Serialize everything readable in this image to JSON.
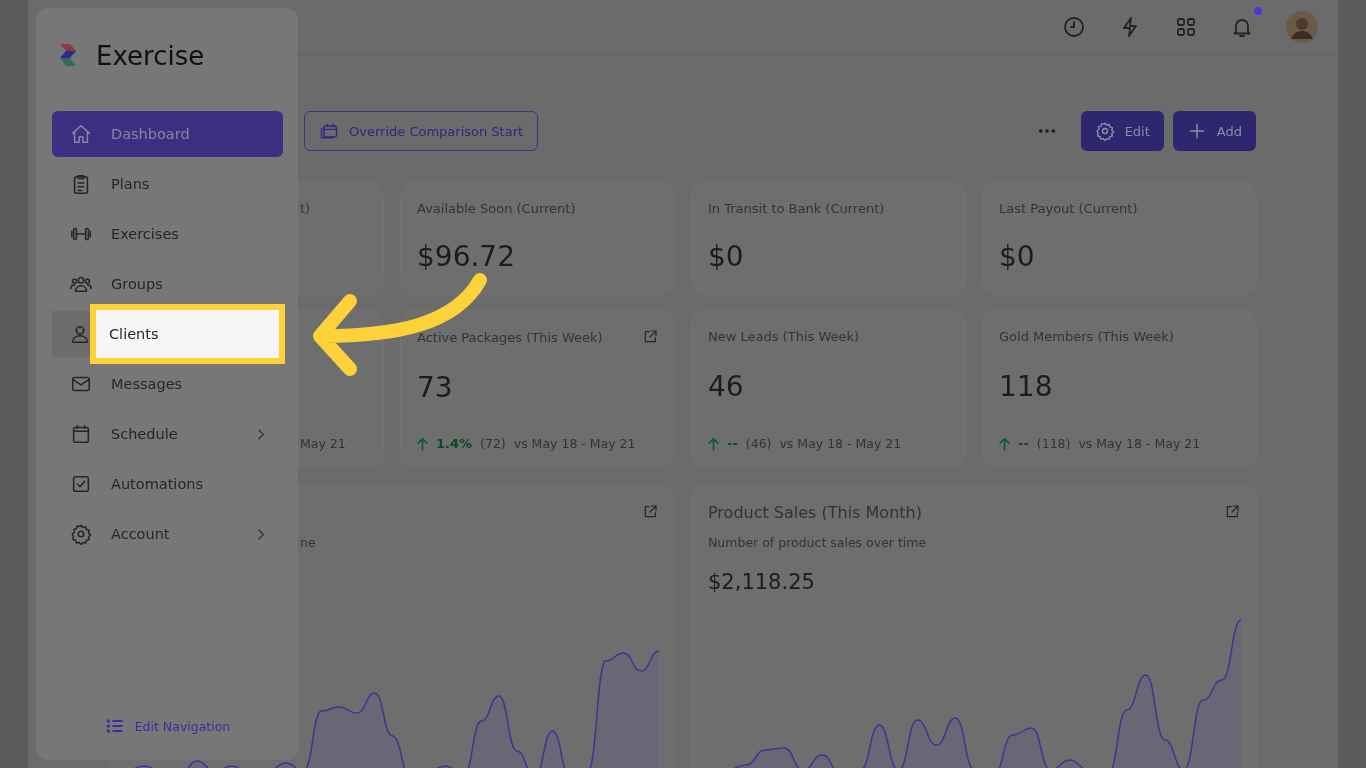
{
  "header": {
    "notifications_unread": true
  },
  "sidebar": {
    "logo": "Exercise",
    "items": [
      {
        "label": "Dashboard",
        "selected": true,
        "highlighted": false,
        "chevron": false
      },
      {
        "label": "Plans",
        "selected": false,
        "highlighted": false,
        "chevron": false
      },
      {
        "label": "Exercises",
        "selected": false,
        "highlighted": false,
        "chevron": false
      },
      {
        "label": "Groups",
        "selected": false,
        "highlighted": false,
        "chevron": false
      },
      {
        "label": "Clients",
        "selected": false,
        "highlighted": true,
        "chevron": false
      },
      {
        "label": "Messages",
        "selected": false,
        "highlighted": false,
        "chevron": false
      },
      {
        "label": "Schedule",
        "selected": false,
        "highlighted": false,
        "chevron": true
      },
      {
        "label": "Automations",
        "selected": false,
        "highlighted": false,
        "chevron": false
      },
      {
        "label": "Account",
        "selected": false,
        "highlighted": false,
        "chevron": true
      }
    ],
    "edit_navigation": "Edit Navigation"
  },
  "toolbar": {
    "override_button": "Override Comparison Start",
    "edit_button": "Edit",
    "add_button": "Add"
  },
  "stat_cards": [
    {
      "kind": "covered",
      "title": "t)"
    },
    {
      "kind": "full",
      "title": "Available Soon (Current)",
      "value": "$96.72",
      "link": false
    },
    {
      "kind": "full",
      "title": "In Transit to Bank (Current)",
      "value": "$0",
      "link": false
    },
    {
      "kind": "full",
      "title": "Last Payout (Current)",
      "value": "$0",
      "link": false
    },
    {
      "kind": "covered",
      "footer": "May 21"
    },
    {
      "kind": "full",
      "title": "Active Packages (This Week)",
      "value": "73",
      "link": true,
      "trend": {
        "change": "1.4%",
        "previous": "(72)",
        "range": "vs May 18 - May 21"
      }
    },
    {
      "kind": "full",
      "title": "New Leads (This Week)",
      "value": "46",
      "link": false,
      "trend": {
        "change": "--",
        "previous": "(46)",
        "range": "vs May 18 - May 21"
      }
    },
    {
      "kind": "full",
      "title": "Gold Members (This Week)",
      "value": "118",
      "link": false,
      "trend": {
        "change": "--",
        "previous": "(118)",
        "range": "vs May 18 - May 21"
      }
    }
  ],
  "charts": [
    {
      "kind": "covered",
      "description": "ne"
    },
    {
      "kind": "full",
      "title": "Product Sales (This Month)",
      "description": "Number of product sales over time",
      "value": "$2,118.25"
    }
  ]
}
